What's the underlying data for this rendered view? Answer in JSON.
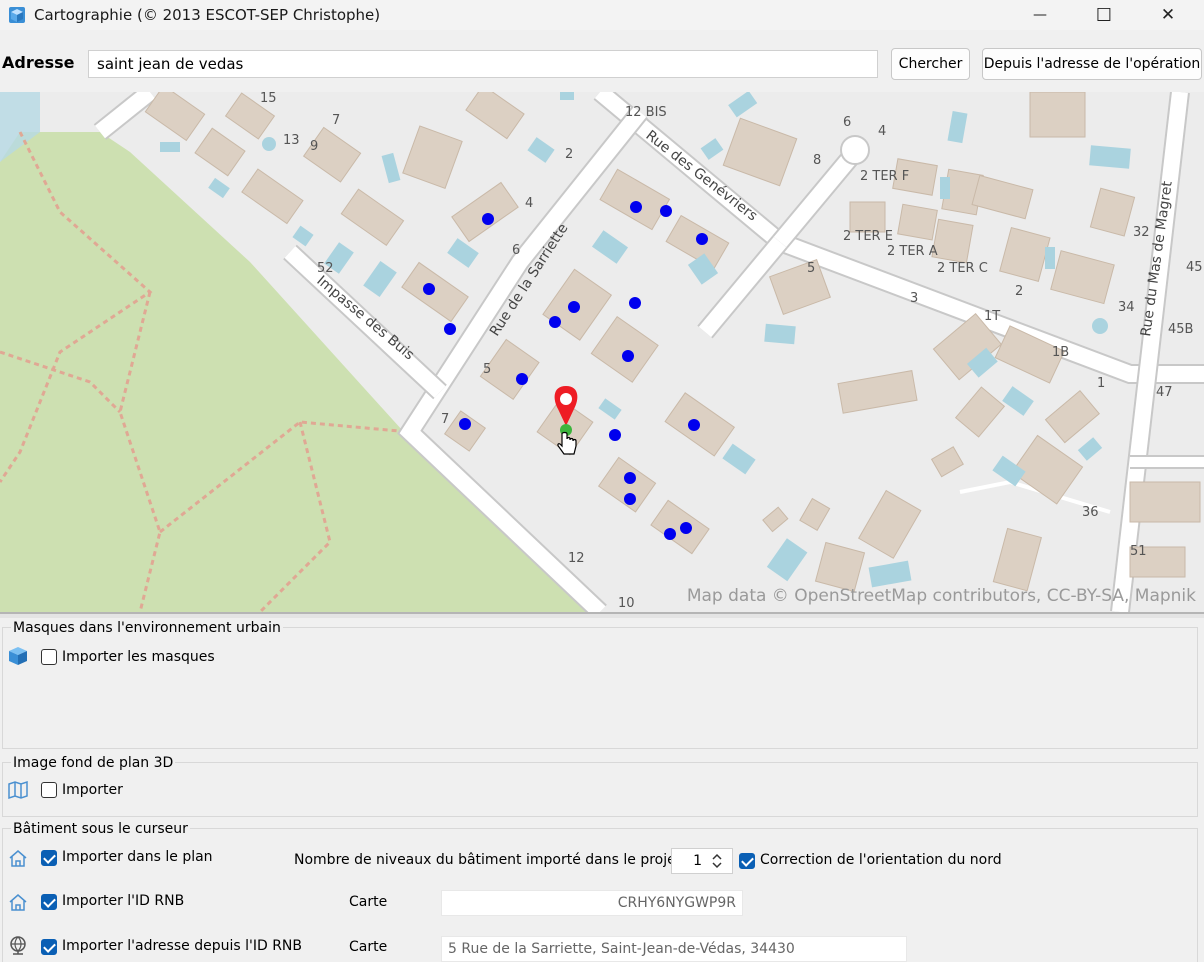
{
  "window": {
    "title": "Cartographie (© 2013 ESCOT-SEP Christophe)",
    "controls": {
      "minimize": "—",
      "maximize": "☐",
      "close": "✕"
    }
  },
  "toolbar": {
    "address_label": "Adresse",
    "address_value": "saint jean de vedas",
    "search_button": "Chercher",
    "from_operation_button": "Depuis l'adresse de l'opération"
  },
  "map": {
    "attribution": "Map data © OpenStreetMap contributors, CC-BY-SA, Mapnik",
    "streets": [
      "Rue des Genévriers",
      "Rue de la Sarriette",
      "Impasse des Buis",
      "Rue du Mas de Magret"
    ],
    "house_numbers": [
      "15",
      "13",
      "9",
      "7",
      "2",
      "12 BIS",
      "6",
      "4",
      "8",
      "2 TER F",
      "2 TER E",
      "2 TER A",
      "2 TER C",
      "32",
      "45",
      "45B",
      "34",
      "47",
      "1",
      "1B",
      "1T",
      "3",
      "5",
      "2",
      "6",
      "4",
      "52",
      "5",
      "7",
      "12",
      "10",
      "36",
      "51"
    ],
    "colors": {
      "park": "#cde0b1",
      "building": "#dcd0c3",
      "water": "#aad3df",
      "road": "#ffffff",
      "marker": "#ee1c24",
      "dot": "#0000ee"
    }
  },
  "masques": {
    "title": "Masques dans l'environnement urbain",
    "import_label": "Importer les masques",
    "import_checked": false
  },
  "image_fond": {
    "title": "Image fond de plan 3D",
    "import_label": "Importer",
    "import_checked": false
  },
  "batiment": {
    "title": "Bâtiment sous le curseur",
    "import_plan_label": "Importer dans le plan",
    "import_plan_checked": true,
    "niveaux_label": "Nombre de niveaux du bâtiment importé dans le projet",
    "niveaux_value": "1",
    "correction_label": "Correction de l'orientation du nord",
    "correction_checked": true,
    "import_rnb_label": "Importer l'ID RNB",
    "import_rnb_checked": true,
    "carte_label": "Carte",
    "rnb_value": "CRHY6NYGWP9R",
    "import_addr_label": "Importer l'adresse depuis l'ID RNB",
    "import_addr_checked": true,
    "carte_label2": "Carte",
    "addr_value": "5 Rue de la Sarriette, Saint-Jean-de-Védas, 34430"
  }
}
